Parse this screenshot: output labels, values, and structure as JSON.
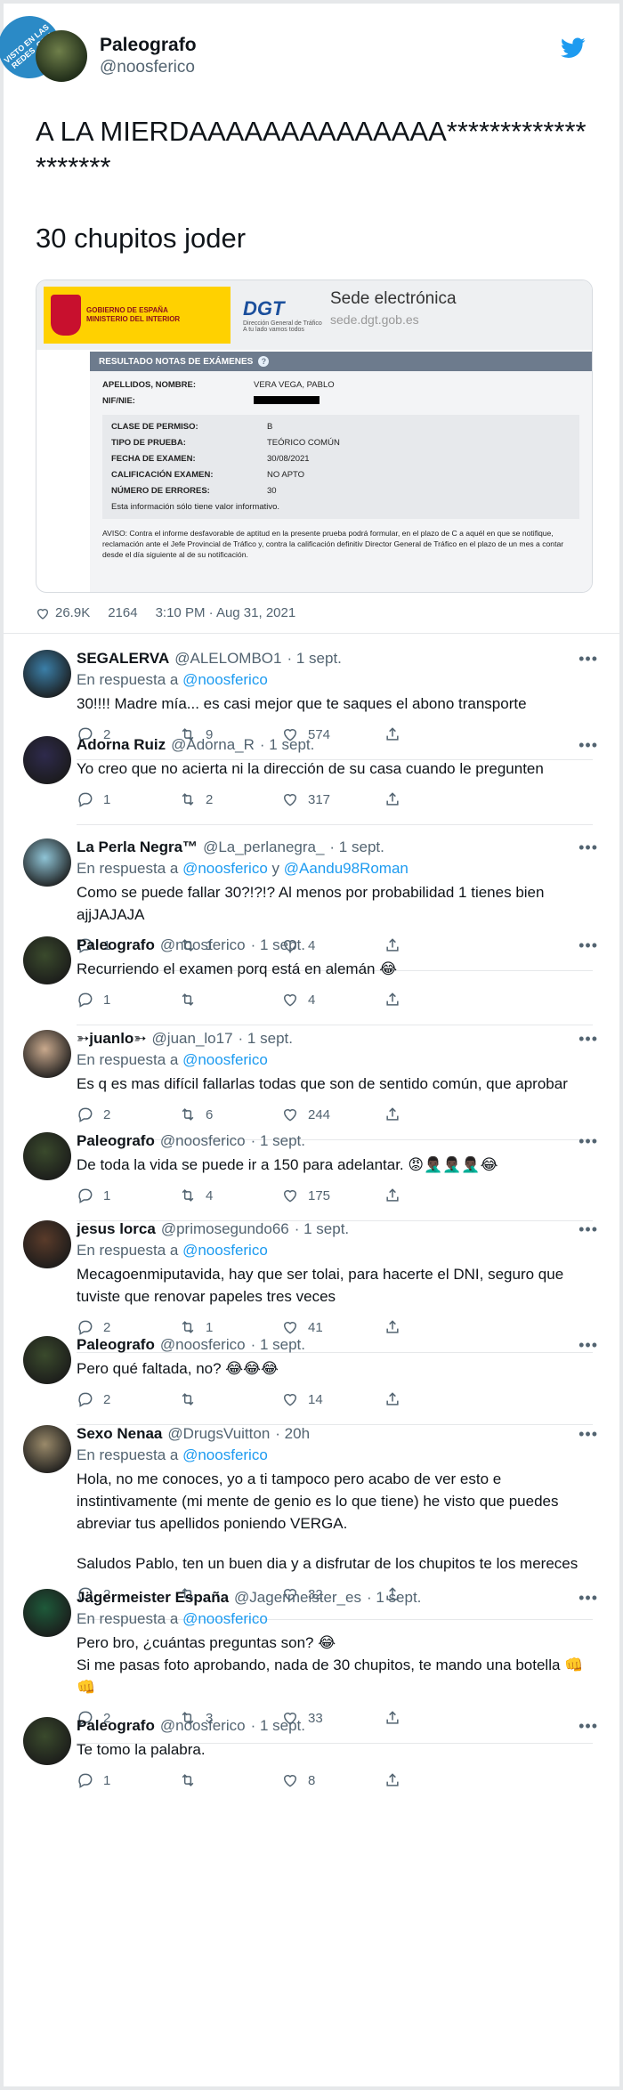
{
  "watermark": "VISTO EN LAS REDES .COM",
  "main_tweet": {
    "name": "Paleografo",
    "handle": "@noosferico",
    "text": "A LA MIERDAAAAAAAAAAAAAA********************",
    "text2": "30 chupitos joder",
    "stats": {
      "likes": "26.9K",
      "retweets": "2164",
      "time": "3:10 PM · Aug 31, 2021"
    }
  },
  "dgt_card": {
    "gov_line1": "GOBIERNO DE ESPAÑA",
    "gov_line2": "MINISTERIO DEL INTERIOR",
    "dgt_brand": "DGT",
    "dgt_sub": "Dirección General de Tráfico",
    "dgt_tag": "A tu lado vamos todos",
    "sede_title": "Sede electrónica",
    "sede_url": "sede.dgt.gob.es",
    "section_title": "RESULTADO NOTAS DE EXÁMENES",
    "apellidos_k": "APELLIDOS, NOMBRE:",
    "apellidos_v": "VERA VEGA, PABLO",
    "nif_k": "NIF/NIE:",
    "clase_k": "CLASE DE PERMISO:",
    "clase_v": "B",
    "tipo_k": "TIPO DE PRUEBA:",
    "tipo_v": "TEÓRICO COMÚN",
    "fecha_k": "FECHA DE EXAMEN:",
    "fecha_v": "30/08/2021",
    "calif_k": "CALIFICACIÓN EXAMEN:",
    "calif_v": "NO APTO",
    "errores_k": "NÚMERO DE ERRORES:",
    "errores_v": "30",
    "info": "Esta información sólo tiene valor informativo.",
    "aviso": "AVISO: Contra el informe desfavorable de aptitud en la presente prueba podrá formular, en el plazo de C a aquél en que se notifique, reclamación ante el Jefe Provincial de Tráfico y, contra la calificación definitiv Director General de Tráfico en el plazo de un mes a contar desde el día siguiente al de su notificación."
  },
  "replies": [
    {
      "name": "SEGALERVA",
      "handle": "@ALELOMBO1",
      "date": "· 1 sept.",
      "replying": "En respuesta a",
      "to": "@noosferico",
      "to2": "",
      "text": "30!!!! Madre mía... es casi mejor que te saques el abono transporte",
      "reply": "2",
      "rt": "9",
      "like": "574"
    },
    {
      "name": "Adorna Ruiz",
      "handle": "@Adorna_R",
      "date": "· 1 sept.",
      "replying": "",
      "to": "",
      "to2": "",
      "text": "Yo creo que no acierta ni la dirección de su casa cuando le pregunten",
      "reply": "1",
      "rt": "2",
      "like": "317"
    },
    {
      "name": "La Perla Negra™",
      "handle": "@La_perlanegra_",
      "date": "· 1 sept.",
      "replying": "En respuesta a",
      "to": "@noosferico",
      "to2": "@Aandu98Roman",
      "text": "Como se puede fallar 30?!?!? Al menos por probabilidad 1 tienes bien ajjJAJAJA",
      "reply": "1",
      "rt": "1",
      "like": "4"
    },
    {
      "name": "Paleografo",
      "handle": "@noosferico",
      "date": "· 1 sept.",
      "replying": "",
      "to": "",
      "to2": "",
      "text": "Recurriendo el examen porq está en alemán 😂",
      "reply": "1",
      "rt": "",
      "like": "4"
    },
    {
      "name": "➳juanlo➳",
      "handle": "@juan_lo17",
      "date": "· 1 sept.",
      "replying": "En respuesta a",
      "to": "@noosferico",
      "to2": "",
      "text": "Es q es mas difícil fallarlas todas que son de sentido común, que aprobar",
      "reply": "2",
      "rt": "6",
      "like": "244"
    },
    {
      "name": "Paleografo",
      "handle": "@noosferico",
      "date": "· 1 sept.",
      "replying": "",
      "to": "",
      "to2": "",
      "text": "De toda la vida se puede ir a 150 para adelantar. 😡🤦🏿‍♂️🤦🏿‍♂️🤦🏿‍♂️😂",
      "reply": "1",
      "rt": "4",
      "like": "175"
    },
    {
      "name": "jesus lorca",
      "handle": "@primosegundo66",
      "date": "· 1 sept.",
      "replying": "En respuesta a",
      "to": "@noosferico",
      "to2": "",
      "text": "Mecagoenmiputavida, hay que ser tolai, para hacerte el DNI, seguro que tuviste que renovar papeles tres veces",
      "reply": "2",
      "rt": "1",
      "like": "41"
    },
    {
      "name": "Paleografo",
      "handle": "@noosferico",
      "date": "· 1 sept.",
      "replying": "",
      "to": "",
      "to2": "",
      "text": "Pero qué faltada, no? 😂😂😂",
      "reply": "2",
      "rt": "",
      "like": "14"
    },
    {
      "name": "Sexo Nenaa",
      "handle": "@DrugsVuitton",
      "date": "· 20h",
      "replying": "En respuesta a",
      "to": "@noosferico",
      "to2": "",
      "text": "Hola, no me conoces, yo a ti tampoco pero acabo de ver esto e instintivamente (mi mente de genio es lo que tiene) he visto que puedes abreviar tus apellidos poniendo VERGA.",
      "text_b": "Saludos Pablo, ten un buen dia y a disfrutar de los chupitos te los mereces",
      "reply": "2",
      "rt": "",
      "like": "32"
    },
    {
      "name": "Jägermeister España",
      "handle": "@Jagermeister_es",
      "date": "· 1 sept.",
      "replying": "En respuesta a",
      "to": "@noosferico",
      "to2": "",
      "text": "Pero bro, ¿cuántas preguntas son? 😂",
      "text_b": "Si me pasas foto aprobando, nada de 30 chupitos, te mando una botella 👊👊",
      "reply": "2",
      "rt": "3",
      "like": "33"
    },
    {
      "name": "Paleografo",
      "handle": "@noosferico",
      "date": "· 1 sept.",
      "replying": "",
      "to": "",
      "to2": "",
      "text": "Te tomo la palabra.",
      "reply": "1",
      "rt": "",
      "like": "8"
    }
  ],
  "colors": {
    "link": "#1d9bf0",
    "secondary_text": "#536471",
    "text": "#0f1419"
  },
  "icons": [
    "reply-icon",
    "retweet-icon",
    "heart-icon",
    "share-icon",
    "twitter-bird-icon",
    "more-dots-icon"
  ]
}
